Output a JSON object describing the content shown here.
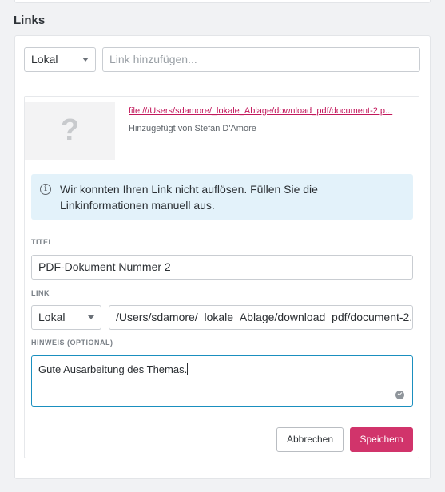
{
  "section": {
    "title": "Links"
  },
  "add_link": {
    "source_select": "Lokal",
    "input_placeholder": "Link hinzufügen..."
  },
  "link_card": {
    "thumbnail_glyph": "?",
    "file_url": "file:///Users/sdamore/_lokale_Ablage/download_pdf/document-2.p...",
    "added_by": "Hinzugefügt von Stefan D'Amore",
    "info_message": "Wir konnten Ihren Link nicht auflösen. Füllen Sie die Linkinformationen manuell aus.",
    "title_label": "TITEL",
    "title_value": "PDF-Dokument Nummer 2",
    "link_label": "LINK",
    "link_source_select": "Lokal",
    "link_value": "/Users/sdamore/_lokale_Ablage/download_pdf/document-2.",
    "note_label": "HINWEIS (OPTIONAL)",
    "note_value": "Gute Ausarbeitung des Themas.",
    "cancel_label": "Abbrechen",
    "save_label": "Speichern"
  },
  "colors": {
    "accent": "#d1346b",
    "link": "#c2185b",
    "info_background": "#e3f2fa",
    "focus_border": "#1a8fbf"
  }
}
